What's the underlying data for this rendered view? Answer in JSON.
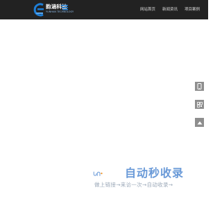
{
  "brand": {
    "name": "韵涵科技",
    "tagline": "YUNHAN TECHNOLOGY"
  },
  "nav": {
    "items": [
      {
        "label": "网站首页"
      },
      {
        "label": "新闻资讯"
      },
      {
        "label": "项目案例"
      }
    ]
  },
  "side_tools": [
    {
      "icon": "phone-icon"
    },
    {
      "icon": "wechat-qrcode-icon"
    },
    {
      "icon": "back-to-top-icon"
    }
  ],
  "footer_brand": {
    "title": "自动秒收录",
    "subtitle": "做上链接→来访一次→自动收录→"
  },
  "colors": {
    "header_bg": "#222222",
    "logo_blue": "#1e7fd8",
    "side_button_bg": "#8e8e8e",
    "footer_brand_blue": "#6a9ad8",
    "footer_brand_orange": "#f0a040",
    "footer_subtitle": "#9ba8b8"
  }
}
